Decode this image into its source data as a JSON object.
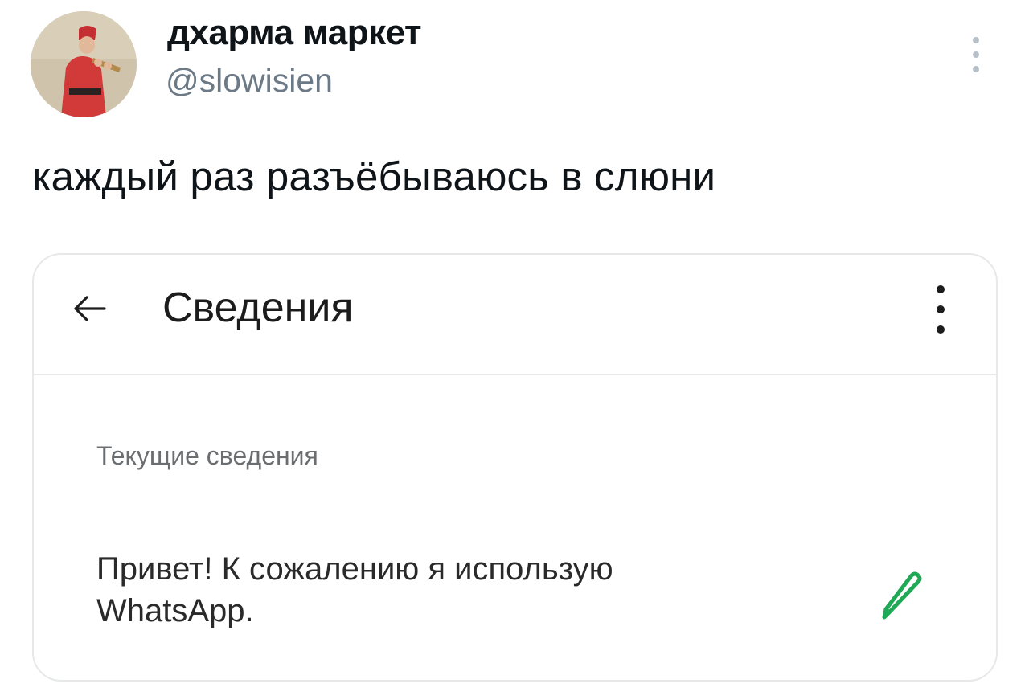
{
  "tweet": {
    "display_name": "дхарма маркет",
    "handle": "@slowisien",
    "text": "каждый раз разъёбываюсь в слюни",
    "more_icon": "more-horizontal-icon"
  },
  "screenshot": {
    "title": "Сведения",
    "back_icon": "arrow-left-icon",
    "menu_icon": "more-vertical-icon",
    "section_label": "Текущие сведения",
    "about_line1": "Привет! К сожалению я использую",
    "about_line2": "WhatsApp.",
    "edit_icon": "pencil-icon",
    "accent_color": "#1fa855"
  }
}
